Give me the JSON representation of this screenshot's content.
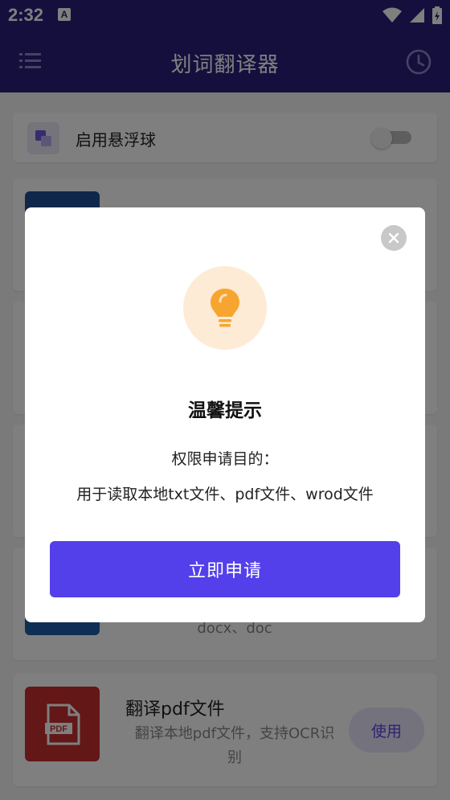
{
  "status_bar": {
    "time": "2:32",
    "a_badge": "A"
  },
  "app_bar": {
    "title": "划词翻译器"
  },
  "floating_ball": {
    "label": "启用悬浮球",
    "enabled": false
  },
  "tools": [
    {
      "title": "",
      "desc": "",
      "color": "#1e4f97"
    },
    {
      "title": "",
      "desc": "",
      "color": "#ffffff"
    },
    {
      "title": "",
      "desc": "",
      "color": "#ffffff"
    },
    {
      "title": "",
      "desc": "docx、doc",
      "color": "#1a5ea8",
      "use_label": ""
    },
    {
      "title": "翻译pdf文件",
      "desc": "翻译本地pdf文件，支持OCR识别",
      "color": "#c62f2f",
      "use_label": "使用",
      "icon_text": "PDF"
    }
  ],
  "dialog": {
    "title": "温馨提示",
    "line1": "权限申请目的：",
    "line2": "用于读取本地txt文件、pdf文件、wrod文件",
    "button": "立即申请"
  },
  "colors": {
    "primary": "#2a1f7c",
    "accent": "#5340ea",
    "bulb": "#f7a530"
  }
}
